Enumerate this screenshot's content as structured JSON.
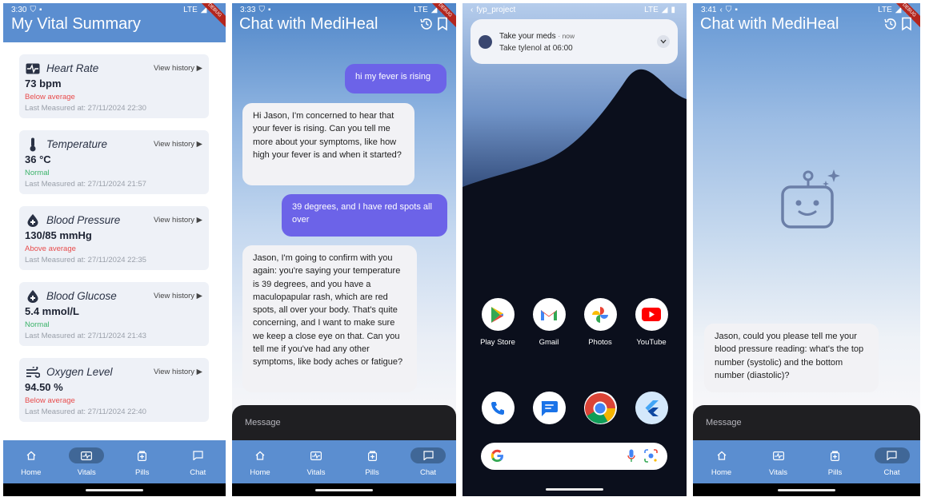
{
  "panel1": {
    "status": {
      "time": "3:30",
      "network": "LTE"
    },
    "debug_banner": "DEBUG",
    "title": "My Vital Summary",
    "history_label": "View history ▶",
    "vitals": [
      {
        "name": "Heart Rate",
        "icon": "heart-rate-icon",
        "value": "73 bpm",
        "status": "Below average",
        "status_kind": "low",
        "last": "Last Measured at: 27/11/2024 22:30"
      },
      {
        "name": "Temperature",
        "icon": "thermometer-icon",
        "value": "36 °C",
        "status": "Normal",
        "status_kind": "normal",
        "last": "Last Measured at: 27/11/2024 21:57"
      },
      {
        "name": "Blood Pressure",
        "icon": "blood-drop-icon",
        "value": "130/85 mmHg",
        "status": "Above average",
        "status_kind": "high",
        "last": "Last Measured at: 27/11/2024 22:35"
      },
      {
        "name": "Blood Glucose",
        "icon": "blood-drop-icon",
        "value": "5.4 mmol/L",
        "status": "Normal",
        "status_kind": "normal",
        "last": "Last Measured at: 27/11/2024 21:43"
      },
      {
        "name": "Oxygen Level",
        "icon": "air-icon",
        "value": "94.50 %",
        "status": "Below average",
        "status_kind": "low",
        "last": "Last Measured at: 27/11/2024 22:40"
      }
    ],
    "active_nav": 1
  },
  "nav": [
    {
      "label": "Home",
      "icon": "home-icon"
    },
    {
      "label": "Vitals",
      "icon": "vitals-icon"
    },
    {
      "label": "Pills",
      "icon": "pills-icon"
    },
    {
      "label": "Chat",
      "icon": "chat-icon"
    }
  ],
  "panel2": {
    "status": {
      "time": "3:33",
      "network": "LTE"
    },
    "debug_banner": "DEBUG",
    "title": "Chat with MediHeal",
    "messages": [
      {
        "from": "user",
        "text": "hi my fever is rising"
      },
      {
        "from": "bot",
        "text": "Hi Jason, I'm concerned to hear that your fever is rising. Can you tell me more about your symptoms, like how high your fever is and when it started?"
      },
      {
        "from": "user",
        "text": "39 degrees, and I have red spots all over"
      },
      {
        "from": "bot",
        "text": "Jason, I'm going to confirm with you again: you're saying your temperature is 39 degrees, and you have a maculopapular rash, which are red spots, all over your body. That's quite concerning, and I want to make sure we keep a close eye on that. Can you tell me if you've had any other symptoms, like body aches or fatigue?"
      }
    ],
    "input_placeholder": "Message",
    "active_nav": 3
  },
  "panel3": {
    "status": {
      "label": "fyp_project",
      "network": "LTE"
    },
    "notification": {
      "title": "Take your meds",
      "time": "· now",
      "body": "Take tylenol at 06:00"
    },
    "apps_row1": [
      {
        "name": "Play Store",
        "icon": "play-store-icon"
      },
      {
        "name": "Gmail",
        "icon": "gmail-icon"
      },
      {
        "name": "Photos",
        "icon": "photos-icon"
      },
      {
        "name": "YouTube",
        "icon": "youtube-icon"
      }
    ],
    "dock": [
      {
        "icon": "phone-icon"
      },
      {
        "icon": "messages-icon"
      },
      {
        "icon": "chrome-icon"
      },
      {
        "icon": "flutter-icon"
      }
    ]
  },
  "panel4": {
    "status": {
      "time": "3:41",
      "network": "LTE"
    },
    "debug_banner": "DEBUG",
    "title": "Chat with MediHeal",
    "messages": [
      {
        "from": "bot",
        "text": "Jason, could you please tell me your blood pressure reading: what's the top number (systolic) and the bottom number (diastolic)?"
      }
    ],
    "input_placeholder": "Message",
    "active_nav": 3
  }
}
